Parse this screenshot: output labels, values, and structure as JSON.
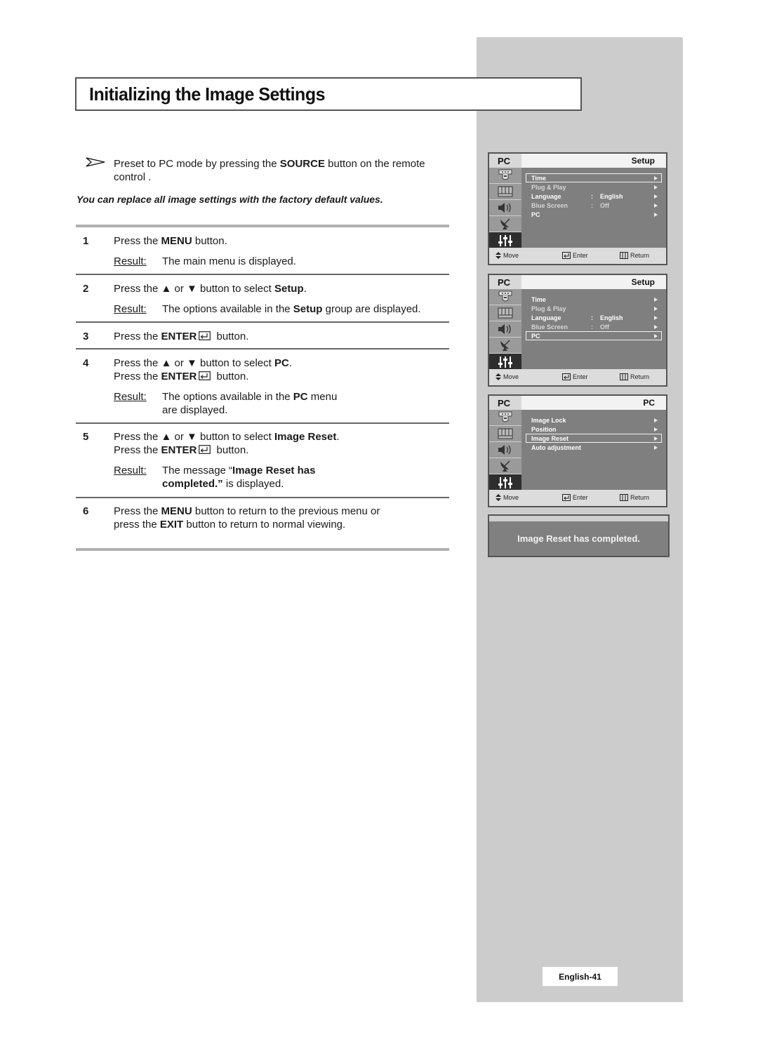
{
  "title": "Initializing the Image Settings",
  "note": {
    "icon": "arrow-right-icon",
    "pre": "Preset to PC mode by pressing the ",
    "bold": "SOURCE",
    "post": " button on the remote control ."
  },
  "intro": "You can replace all image settings with the factory default values.",
  "steps": [
    {
      "num": "1",
      "lines": [
        {
          "pre": "Press the ",
          "bold": "MENU",
          "post": " button."
        }
      ],
      "result_label": "Result:",
      "result": {
        "pre": "The main menu is displayed.",
        "bold": "",
        "post": ""
      }
    },
    {
      "num": "2",
      "lines": [
        {
          "pre": "Press the ▲ or ▼ button to select ",
          "bold": "Setup",
          "post": "."
        }
      ],
      "result_label": "Result:",
      "result": {
        "pre": "The options available in the ",
        "bold": "Setup",
        "post": " group are displayed."
      }
    },
    {
      "num": "3",
      "lines": [
        {
          "pre": "Press the ",
          "bold": "ENTER",
          "post": " button."
        }
      ]
    },
    {
      "num": "4",
      "lines": [
        {
          "pre": "Press the ▲ or ▼ button to select ",
          "bold": "PC",
          "post": "."
        },
        {
          "pre": "Press the ",
          "bold": "ENTER",
          "post": " button."
        }
      ],
      "result_label": "Result:",
      "result": {
        "pre": "The options available in the ",
        "bold": "PC",
        "post": " menu are displayed."
      }
    },
    {
      "num": "5",
      "lines": [
        {
          "pre": "Press the ▲ or ▼ button to select ",
          "bold": "Image Reset",
          "post": "."
        },
        {
          "pre": "Press the ",
          "bold": "ENTER",
          "post": " button."
        }
      ],
      "result_label": "Result:",
      "result": {
        "pre": "The message “",
        "bold": "Image Reset has completed.”",
        "post": " is displayed."
      }
    },
    {
      "num": "6",
      "lines": [
        {
          "pre": "Press the ",
          "bold": "MENU",
          "post": " button to return to the previous menu or"
        },
        {
          "pre": "press the ",
          "bold": "EXIT",
          "post": " button to return to normal viewing."
        }
      ]
    }
  ],
  "osd_screens": [
    {
      "source": "PC",
      "menu_title": "Setup",
      "items": [
        {
          "label": "Time",
          "colon": "",
          "value": "",
          "selected": true,
          "dim": false
        },
        {
          "label": "Plug & Play",
          "colon": "",
          "value": "",
          "selected": false,
          "dim": true
        },
        {
          "label": "Language",
          "colon": ":",
          "value": "English",
          "selected": false,
          "dim": false
        },
        {
          "label": "Blue Screen",
          "colon": ":",
          "value": "Off",
          "selected": false,
          "dim": true
        },
        {
          "label": "PC",
          "colon": "",
          "value": "",
          "selected": false,
          "dim": false
        }
      ]
    },
    {
      "source": "PC",
      "menu_title": "Setup",
      "items": [
        {
          "label": "Time",
          "colon": "",
          "value": "",
          "selected": false,
          "dim": false
        },
        {
          "label": "Plug & Play",
          "colon": "",
          "value": "",
          "selected": false,
          "dim": true
        },
        {
          "label": "Language",
          "colon": ":",
          "value": "English",
          "selected": false,
          "dim": false
        },
        {
          "label": "Blue Screen",
          "colon": ":",
          "value": "Off",
          "selected": false,
          "dim": true
        },
        {
          "label": "PC",
          "colon": "",
          "value": "",
          "selected": true,
          "dim": false
        }
      ]
    },
    {
      "source": "PC",
      "menu_title": "PC",
      "items": [
        {
          "label": "Image Lock",
          "colon": "",
          "value": "",
          "selected": false,
          "dim": false
        },
        {
          "label": "Position",
          "colon": "",
          "value": "",
          "selected": false,
          "dim": false
        },
        {
          "label": "Image Reset",
          "colon": "",
          "value": "",
          "selected": true,
          "dim": false
        },
        {
          "label": "Auto adjustment",
          "colon": "",
          "value": "",
          "selected": false,
          "dim": false
        }
      ]
    }
  ],
  "osd_icons": [
    "input-icon",
    "picture-icon",
    "sound-icon",
    "channel-icon",
    "setup-icon"
  ],
  "osd_footer": {
    "move": "Move",
    "enter": "Enter",
    "return": "Return"
  },
  "message": "Image Reset has completed.",
  "page_number": "English-41"
}
